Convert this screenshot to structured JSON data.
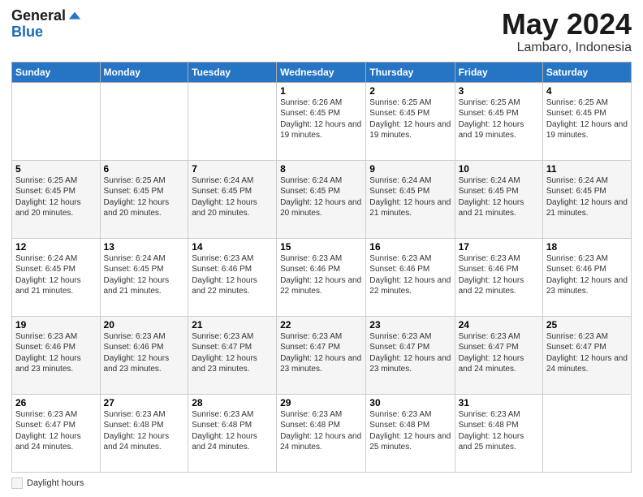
{
  "logo": {
    "general": "General",
    "blue": "Blue"
  },
  "title": {
    "month": "May 2024",
    "location": "Lambaro, Indonesia"
  },
  "weekdays": [
    "Sunday",
    "Monday",
    "Tuesday",
    "Wednesday",
    "Thursday",
    "Friday",
    "Saturday"
  ],
  "weeks": [
    [
      {
        "day": "",
        "info": ""
      },
      {
        "day": "",
        "info": ""
      },
      {
        "day": "",
        "info": ""
      },
      {
        "day": "1",
        "info": "Sunrise: 6:26 AM\nSunset: 6:45 PM\nDaylight: 12 hours and 19 minutes."
      },
      {
        "day": "2",
        "info": "Sunrise: 6:25 AM\nSunset: 6:45 PM\nDaylight: 12 hours and 19 minutes."
      },
      {
        "day": "3",
        "info": "Sunrise: 6:25 AM\nSunset: 6:45 PM\nDaylight: 12 hours and 19 minutes."
      },
      {
        "day": "4",
        "info": "Sunrise: 6:25 AM\nSunset: 6:45 PM\nDaylight: 12 hours and 19 minutes."
      }
    ],
    [
      {
        "day": "5",
        "info": "Sunrise: 6:25 AM\nSunset: 6:45 PM\nDaylight: 12 hours and 20 minutes."
      },
      {
        "day": "6",
        "info": "Sunrise: 6:25 AM\nSunset: 6:45 PM\nDaylight: 12 hours and 20 minutes."
      },
      {
        "day": "7",
        "info": "Sunrise: 6:24 AM\nSunset: 6:45 PM\nDaylight: 12 hours and 20 minutes."
      },
      {
        "day": "8",
        "info": "Sunrise: 6:24 AM\nSunset: 6:45 PM\nDaylight: 12 hours and 20 minutes."
      },
      {
        "day": "9",
        "info": "Sunrise: 6:24 AM\nSunset: 6:45 PM\nDaylight: 12 hours and 21 minutes."
      },
      {
        "day": "10",
        "info": "Sunrise: 6:24 AM\nSunset: 6:45 PM\nDaylight: 12 hours and 21 minutes."
      },
      {
        "day": "11",
        "info": "Sunrise: 6:24 AM\nSunset: 6:45 PM\nDaylight: 12 hours and 21 minutes."
      }
    ],
    [
      {
        "day": "12",
        "info": "Sunrise: 6:24 AM\nSunset: 6:45 PM\nDaylight: 12 hours and 21 minutes."
      },
      {
        "day": "13",
        "info": "Sunrise: 6:24 AM\nSunset: 6:45 PM\nDaylight: 12 hours and 21 minutes."
      },
      {
        "day": "14",
        "info": "Sunrise: 6:23 AM\nSunset: 6:46 PM\nDaylight: 12 hours and 22 minutes."
      },
      {
        "day": "15",
        "info": "Sunrise: 6:23 AM\nSunset: 6:46 PM\nDaylight: 12 hours and 22 minutes."
      },
      {
        "day": "16",
        "info": "Sunrise: 6:23 AM\nSunset: 6:46 PM\nDaylight: 12 hours and 22 minutes."
      },
      {
        "day": "17",
        "info": "Sunrise: 6:23 AM\nSunset: 6:46 PM\nDaylight: 12 hours and 22 minutes."
      },
      {
        "day": "18",
        "info": "Sunrise: 6:23 AM\nSunset: 6:46 PM\nDaylight: 12 hours and 23 minutes."
      }
    ],
    [
      {
        "day": "19",
        "info": "Sunrise: 6:23 AM\nSunset: 6:46 PM\nDaylight: 12 hours and 23 minutes."
      },
      {
        "day": "20",
        "info": "Sunrise: 6:23 AM\nSunset: 6:46 PM\nDaylight: 12 hours and 23 minutes."
      },
      {
        "day": "21",
        "info": "Sunrise: 6:23 AM\nSunset: 6:47 PM\nDaylight: 12 hours and 23 minutes."
      },
      {
        "day": "22",
        "info": "Sunrise: 6:23 AM\nSunset: 6:47 PM\nDaylight: 12 hours and 23 minutes."
      },
      {
        "day": "23",
        "info": "Sunrise: 6:23 AM\nSunset: 6:47 PM\nDaylight: 12 hours and 23 minutes."
      },
      {
        "day": "24",
        "info": "Sunrise: 6:23 AM\nSunset: 6:47 PM\nDaylight: 12 hours and 24 minutes."
      },
      {
        "day": "25",
        "info": "Sunrise: 6:23 AM\nSunset: 6:47 PM\nDaylight: 12 hours and 24 minutes."
      }
    ],
    [
      {
        "day": "26",
        "info": "Sunrise: 6:23 AM\nSunset: 6:47 PM\nDaylight: 12 hours and 24 minutes."
      },
      {
        "day": "27",
        "info": "Sunrise: 6:23 AM\nSunset: 6:48 PM\nDaylight: 12 hours and 24 minutes."
      },
      {
        "day": "28",
        "info": "Sunrise: 6:23 AM\nSunset: 6:48 PM\nDaylight: 12 hours and 24 minutes."
      },
      {
        "day": "29",
        "info": "Sunrise: 6:23 AM\nSunset: 6:48 PM\nDaylight: 12 hours and 24 minutes."
      },
      {
        "day": "30",
        "info": "Sunrise: 6:23 AM\nSunset: 6:48 PM\nDaylight: 12 hours and 25 minutes."
      },
      {
        "day": "31",
        "info": "Sunrise: 6:23 AM\nSunset: 6:48 PM\nDaylight: 12 hours and 25 minutes."
      },
      {
        "day": "",
        "info": ""
      }
    ]
  ],
  "footer": {
    "daylight_label": "Daylight hours"
  }
}
